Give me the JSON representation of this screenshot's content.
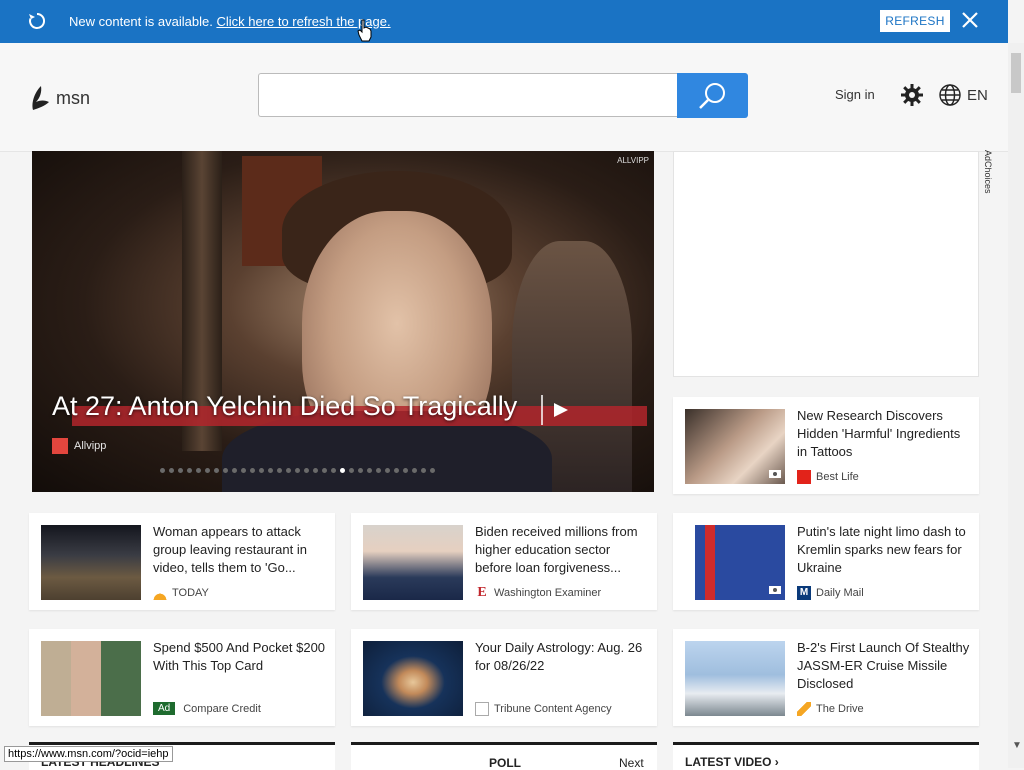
{
  "notification": {
    "message": "New content is available.",
    "link": "Click here to refresh the page.",
    "refresh_label": "REFRESH"
  },
  "header": {
    "logo_text": "msn",
    "search_placeholder": "",
    "signin_label": "Sign in",
    "language": "EN"
  },
  "hero": {
    "title": "At 27: Anton Yelchin Died So Tragically",
    "source": "Allvipp",
    "watermark": "ALLVIPP",
    "slide_count": 31,
    "active_slide": 20
  },
  "ad": {
    "adchoices_label": "AdChoices"
  },
  "cards": [
    {
      "title": "New Research Discovers Hidden 'Harmful' Ingredients in Tattoos",
      "source": "Best Life",
      "source_color": "#e2231a",
      "photo": true
    },
    {
      "title": "Woman appears to attack group leaving restaurant in video, tells them to 'Go...",
      "source": "TODAY",
      "source_color": "#f5a623",
      "photo": false
    },
    {
      "title": "Biden received millions from higher education sector before loan forgiveness...",
      "source": "Washington Examiner",
      "source_color": "#c1272d",
      "photo": false
    },
    {
      "title": "Putin's late night limo dash to Kremlin sparks new fears for Ukraine",
      "source": "Daily Mail",
      "source_color": "#0a3a7a",
      "photo": true
    },
    {
      "title": "Spend $500 And Pocket $200 With This Top Card",
      "source": "Compare Credit",
      "ad_badge": "Ad",
      "photo": false
    },
    {
      "title": "Your Daily Astrology: Aug. 26 for 08/26/22",
      "source": "Tribune Content Agency",
      "source_color": "#aaaaaa",
      "photo": false
    },
    {
      "title": "B-2's First Launch Of Stealthy JASSM-ER Cruise Missile Disclosed",
      "source": "The Drive",
      "source_color": "#f5a623",
      "photo": false
    }
  ],
  "bottom": {
    "headlines_label": "LATEST HEADLINES",
    "poll_label": "POLL",
    "next_label": "Next",
    "video_label": "LATEST VIDEO"
  },
  "status_url": "https://www.msn.com/?ocid=iehp"
}
